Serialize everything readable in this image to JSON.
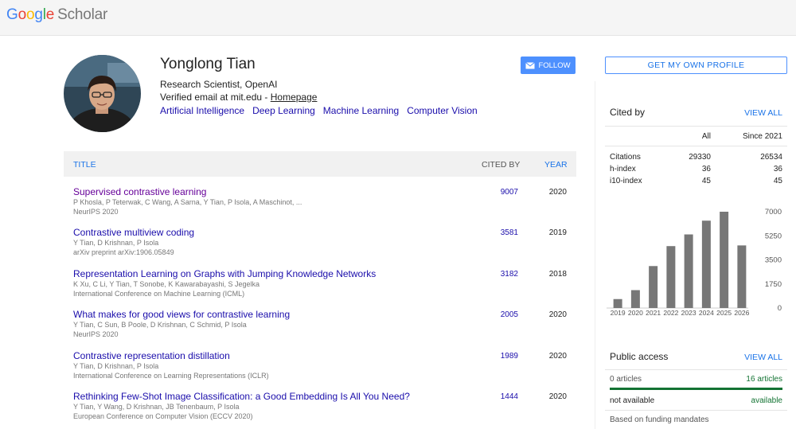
{
  "header": {
    "logo_parts": [
      "G",
      "o",
      "o",
      "g",
      "l",
      "e"
    ],
    "logo_product": "Scholar"
  },
  "profile": {
    "name": "Yonglong Tian",
    "affiliation": "Research Scientist, OpenAI",
    "email_text": "Verified email at mit.edu - ",
    "homepage_label": "Homepage",
    "interests": [
      "Artificial Intelligence",
      "Deep Learning",
      "Machine Learning",
      "Computer Vision"
    ],
    "follow_label": "FOLLOW"
  },
  "get_profile_label": "GET MY OWN PROFILE",
  "table": {
    "col_title": "TITLE",
    "col_cited": "CITED BY",
    "col_year": "YEAR",
    "rows": [
      {
        "title": "Supervised contrastive learning",
        "authors": "P Khosla, P Teterwak, C Wang, A Sarna, Y Tian, P Isola, A Maschinot, ...",
        "venue": "NeurIPS 2020",
        "cited": "9007",
        "year": "2020",
        "visited": true
      },
      {
        "title": "Contrastive multiview coding",
        "authors": "Y Tian, D Krishnan, P Isola",
        "venue": "arXiv preprint arXiv:1906.05849",
        "cited": "3581",
        "year": "2019",
        "visited": false
      },
      {
        "title": "Representation Learning on Graphs with Jumping Knowledge Networks",
        "authors": "K Xu, C Li, Y Tian, T Sonobe, K Kawarabayashi, S Jegelka",
        "venue": "International Conference on Machine Learning (ICML)",
        "cited": "3182",
        "year": "2018",
        "visited": false
      },
      {
        "title": "What makes for good views for contrastive learning",
        "authors": "Y Tian, C Sun, B Poole, D Krishnan, C Schmid, P Isola",
        "venue": "NeurIPS 2020",
        "cited": "2005",
        "year": "2020",
        "visited": false
      },
      {
        "title": "Contrastive representation distillation",
        "authors": "Y Tian, D Krishnan, P Isola",
        "venue": "International Conference on Learning Representations (ICLR)",
        "cited": "1989",
        "year": "2020",
        "visited": false
      },
      {
        "title": "Rethinking Few-Shot Image Classification: a Good Embedding Is All You Need?",
        "authors": "Y Tian, Y Wang, D Krishnan, JB Tenenbaum, P Isola",
        "venue": "European Conference on Computer Vision (ECCV 2020)",
        "cited": "1444",
        "year": "2020",
        "visited": false
      }
    ]
  },
  "cited_by": {
    "title": "Cited by",
    "view_all": "VIEW ALL",
    "col_all": "All",
    "col_since": "Since 2021",
    "rows": [
      {
        "label": "Citations",
        "all": "29330",
        "since": "26534"
      },
      {
        "label": "h-index",
        "all": "36",
        "since": "36"
      },
      {
        "label": "i10-index",
        "all": "45",
        "since": "45"
      }
    ]
  },
  "chart_data": {
    "type": "bar",
    "categories": [
      "2019",
      "2020",
      "2021",
      "2022",
      "2023",
      "2024",
      "2025",
      "2026"
    ],
    "values": [
      650,
      1300,
      3050,
      4500,
      5350,
      6350,
      7000,
      4550
    ],
    "y_ticks": [
      "7000",
      "5250",
      "3500",
      "1750",
      "0"
    ],
    "ylim": [
      0,
      7000
    ],
    "bar_color": "#777777"
  },
  "public_access": {
    "title": "Public access",
    "view_all": "VIEW ALL",
    "left_count": "0 articles",
    "right_count": "16 articles",
    "left_status": "not available",
    "right_status": "available",
    "footnote": "Based on funding mandates"
  }
}
